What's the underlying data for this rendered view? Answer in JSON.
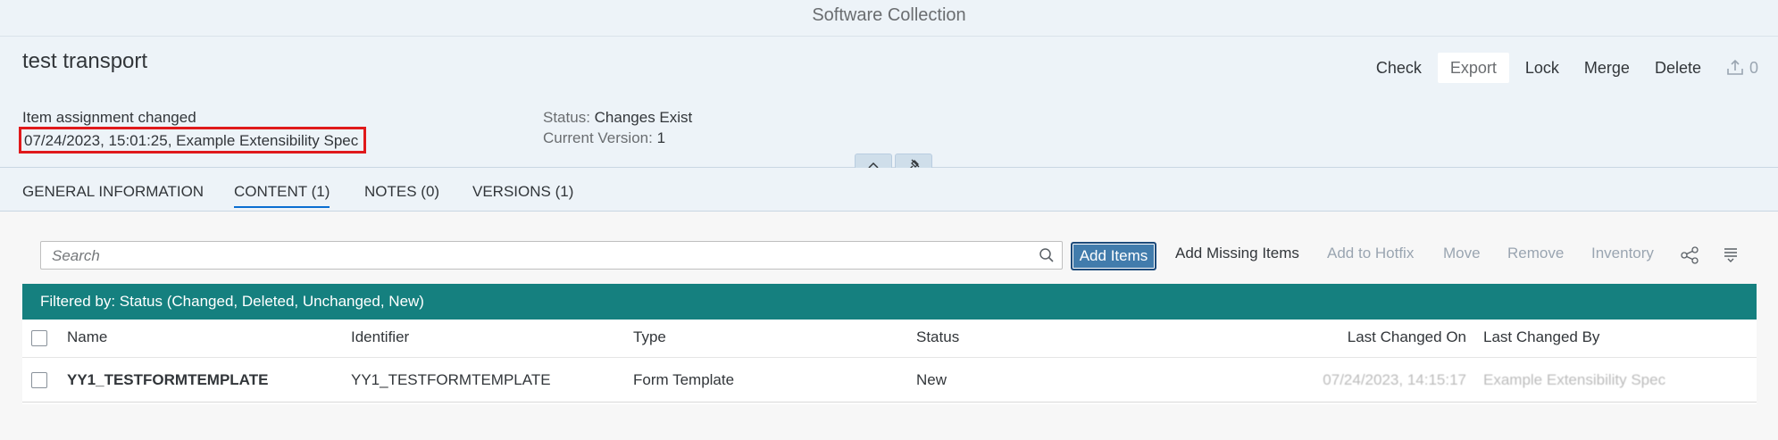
{
  "shell": {
    "title": "Software Collection"
  },
  "header": {
    "title": "test transport",
    "actions": {
      "check": "Check",
      "export": "Export",
      "lock": "Lock",
      "merge": "Merge",
      "delete": "Delete",
      "upload_count": "0"
    },
    "attr_line1": "Item assignment changed",
    "attr_line2": "07/24/2023, 15:01:25, Example Extensibility Spec",
    "status_label": "Status:",
    "status_value": "Changes Exist",
    "version_label": "Current Version:",
    "version_value": "1"
  },
  "tabs": [
    {
      "label": "GENERAL INFORMATION",
      "active": false
    },
    {
      "label": "CONTENT (1)",
      "active": true
    },
    {
      "label": "NOTES (0)",
      "active": false
    },
    {
      "label": "VERSIONS (1)",
      "active": false
    }
  ],
  "toolbar": {
    "search_placeholder": "Search",
    "add_items": "Add Items",
    "add_missing_items": "Add Missing Items",
    "add_to_hotfix": "Add to Hotfix",
    "move": "Move",
    "remove": "Remove",
    "inventory": "Inventory"
  },
  "filter": {
    "text": "Filtered by: Status (Changed, Deleted, Unchanged, New)"
  },
  "table": {
    "columns": [
      "Name",
      "Identifier",
      "Type",
      "Status",
      "Last Changed On",
      "Last Changed By"
    ],
    "rows": [
      {
        "name": "YY1_TESTFORMTEMPLATE",
        "identifier": "YY1_TESTFORMTEMPLATE",
        "type": "Form Template",
        "status": "New",
        "last_changed_on": "07/24/2023, 14:15:17",
        "last_changed_by": "Example Extensibility Spec"
      }
    ]
  },
  "colors": {
    "accent": "#0a6ed1",
    "filter_bar": "#15807f",
    "button": "#427cac",
    "highlight_box": "#e0191b"
  },
  "icons": [
    "upload-icon",
    "collapse-header-icon",
    "pin-icon",
    "search-icon",
    "share-icon",
    "column-settings-icon"
  ]
}
